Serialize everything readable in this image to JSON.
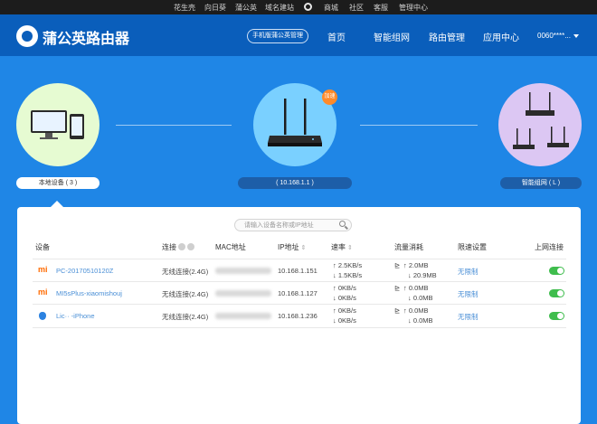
{
  "topbar": {
    "links": [
      "花生壳",
      "向日葵",
      "蒲公英",
      "域名建站",
      "商城",
      "社区",
      "客服",
      "管理中心"
    ]
  },
  "header": {
    "brand": "蒲公英路由器",
    "manager_button": "手机版蒲公英管理",
    "nav": [
      "首页",
      "智能组网",
      "路由管理",
      "应用中心"
    ],
    "user": "0060****..."
  },
  "topology": {
    "local_label": "本地设备 ( 3 )",
    "router_label": "( 10.168.1.1 )",
    "mesh_label": "智能组网 ( L )",
    "speed_badge": "加速"
  },
  "search": {
    "placeholder": "请输入设备名称或IP地址"
  },
  "table": {
    "headers": {
      "device": "设备",
      "conn": "连接",
      "mac": "MAC地址",
      "ip": "IP地址",
      "speed": "速率",
      "traffic": "流量消耗",
      "limit": "限速设置",
      "online": "上网连接"
    },
    "rows": [
      {
        "icon": "xiaomi-icon",
        "name": "PC-20170510120Z",
        "conn": "无线连接(2.4G)",
        "ip": "10.168.1.151",
        "up": "↑ 2.5KB/s",
        "down": "↓ 1.5KB/s",
        "t_up": "↑ 2.0MB",
        "t_down": "↓ 20.9MB",
        "limit": "无限制",
        "online": true
      },
      {
        "icon": "xiaomi-icon",
        "name": "MI5sPlus-xiaomishouj",
        "conn": "无线连接(2.4G)",
        "ip": "10.168.1.127",
        "up": "↑ 0KB/s",
        "down": "↓ 0KB/s",
        "t_up": "↑ 0.0MB",
        "t_down": "↓ 0.0MB",
        "limit": "无限制",
        "online": true
      },
      {
        "icon": "apple-icon",
        "name": "Lic·· -iPhone",
        "conn": "无线连接(2.4G)",
        "ip": "10.168.1.236",
        "up": "↑ 0KB/s",
        "down": "↓ 0KB/s",
        "t_up": "↑ 0.0MB",
        "t_down": "↓ 0.0MB",
        "limit": "无限制",
        "online": true
      }
    ]
  }
}
